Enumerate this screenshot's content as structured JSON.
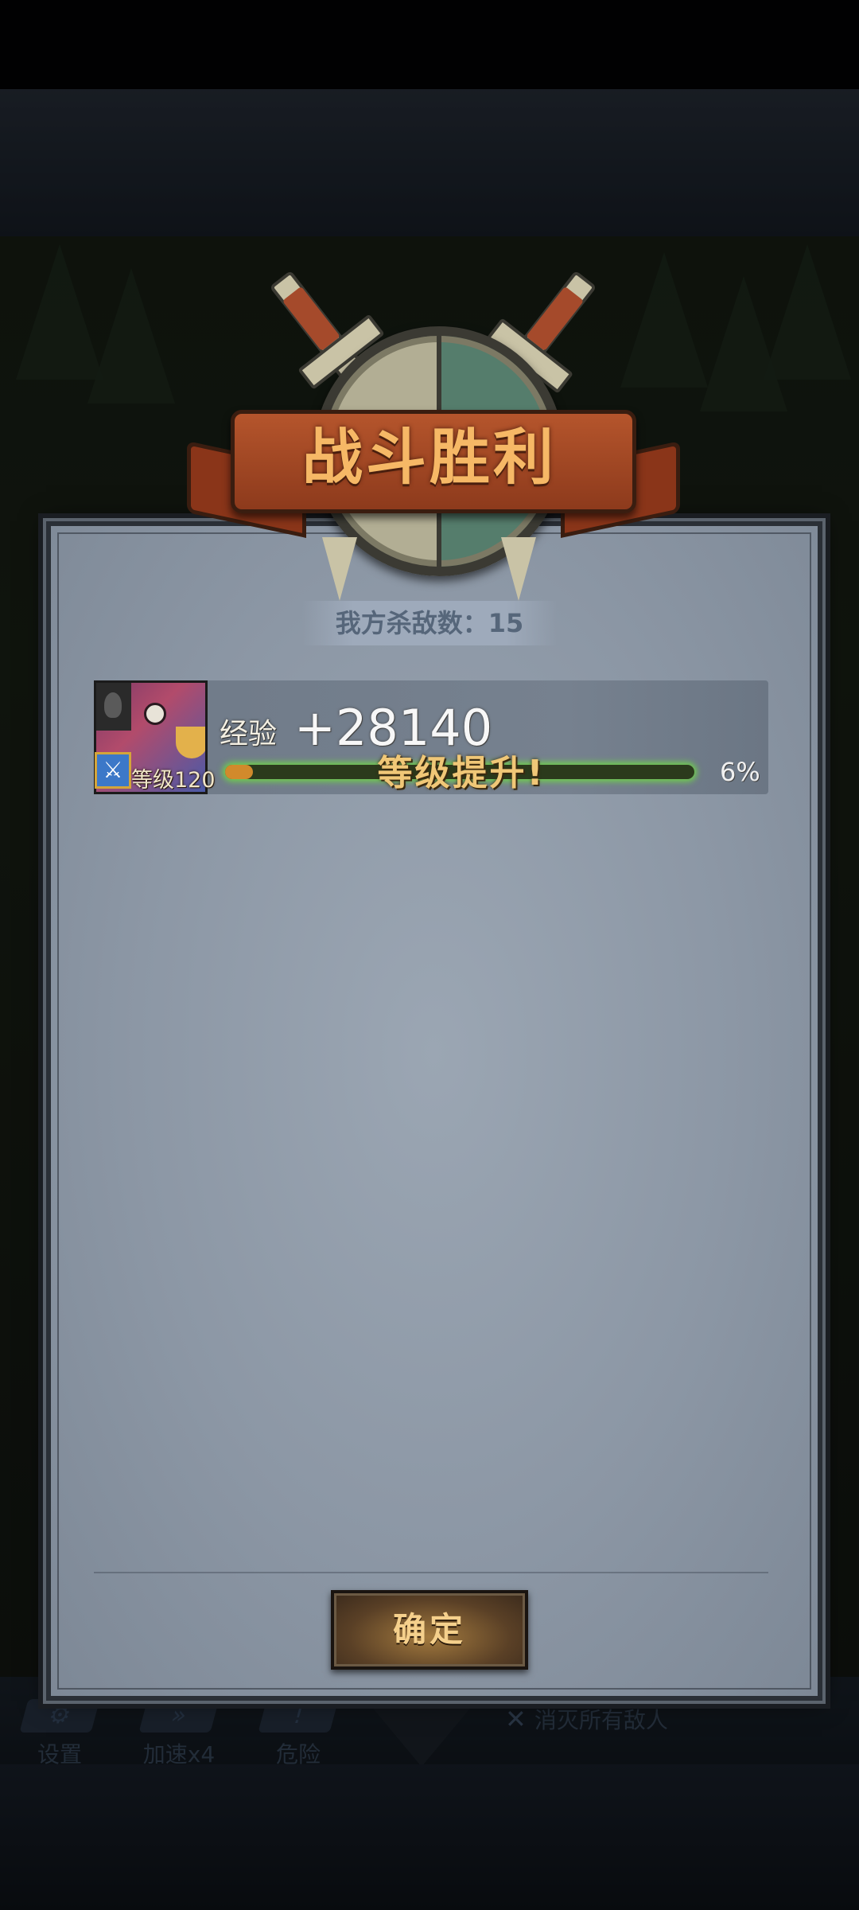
{
  "result": {
    "title": "战斗胜利",
    "kills_text": "我方杀敌数：15"
  },
  "hero": {
    "level_text": "等级120",
    "exp_label": "经验",
    "exp_gain": "+28140",
    "level_up_text": "等级提升!",
    "exp_percent_text": "6%",
    "exp_progress": 0.06
  },
  "confirm_button": {
    "label": "确定"
  },
  "bottom_bar": {
    "settings_label": "设置",
    "speed_label": "加速x4",
    "danger_label": "危险",
    "objective_text": "消灭所有敌人"
  },
  "colors": {
    "title": "#f6b866",
    "exp_glow": "#6fd34a",
    "exp_fill": "#d18a2c",
    "button_text": "#f5d08c"
  }
}
